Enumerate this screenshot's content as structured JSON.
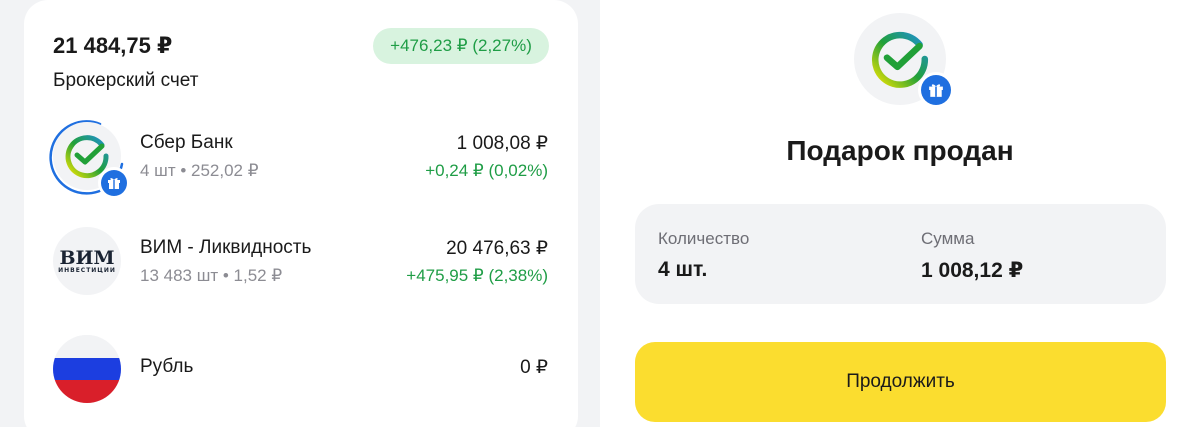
{
  "portfolio": {
    "total": "21 484,75 ₽",
    "change": "+476,23 ₽ (2,27%)",
    "account_label": "Брокерский счет"
  },
  "holdings": [
    {
      "name": "Сбер Банк",
      "sub": "4 шт • 252,02 ₽",
      "value": "1 008,08 ₽",
      "delta": "+0,24 ₽ (0,02%)",
      "logo": "sber-logo-icon"
    },
    {
      "name": "ВИМ - Ликвидность",
      "sub": "13 483 шт • 1,52 ₽",
      "value": "20 476,63 ₽",
      "delta": "+475,95 ₽ (2,38%)",
      "logo": "vim-logo",
      "logo_text": "ВИМ",
      "logo_subtext": "ИНВЕСТИЦИИ"
    },
    {
      "name": "Рубль",
      "value": "0 ₽",
      "logo": "russian-flag-icon"
    }
  ],
  "gift_result": {
    "title": "Подарок продан",
    "quantity_label": "Количество",
    "quantity_value": "4 шт.",
    "sum_label": "Сумма",
    "sum_value": "1 008,12 ₽",
    "continue_label": "Продолжить"
  },
  "colors": {
    "positive": "#1f9d46",
    "positive_bg": "#d8f3df",
    "accent_yellow": "#fbdd2f",
    "gift_blue": "#1f6fe0",
    "sber_green": "#21a038"
  }
}
